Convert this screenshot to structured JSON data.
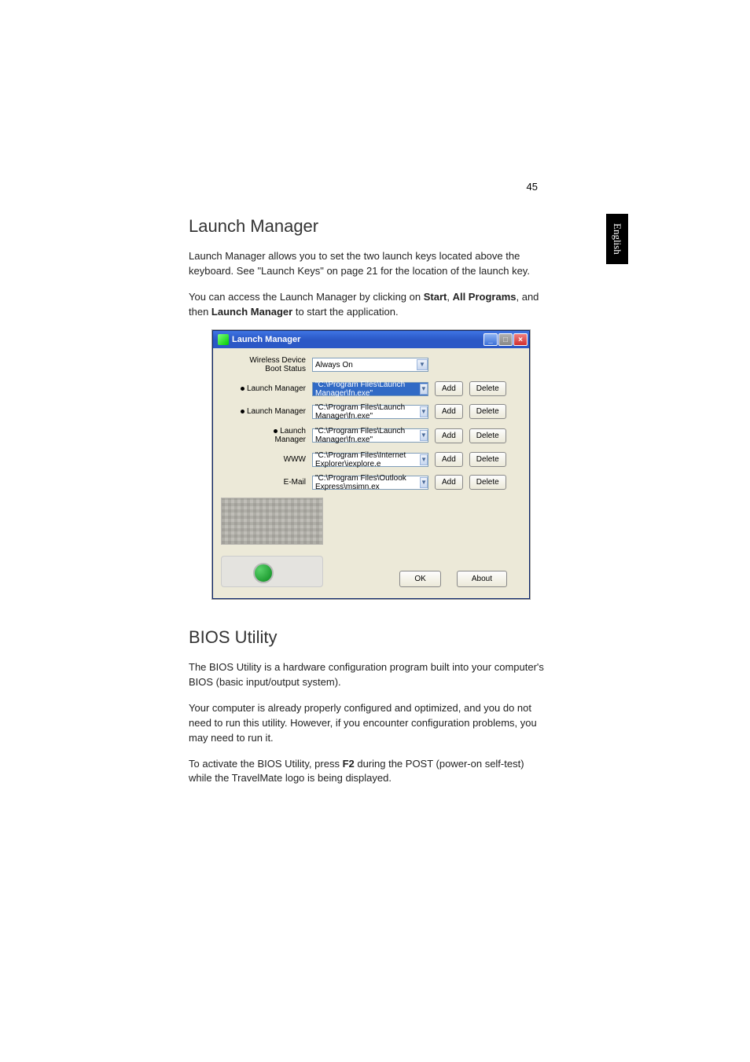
{
  "page_number": "45",
  "side_tab": "English",
  "launch_manager": {
    "heading": "Launch Manager",
    "para1": "Launch Manager allows you to set the two launch keys located above the keyboard. See \"Launch Keys\" on page 21 for the location of the launch key.",
    "para2_pre": "You can access the Launch Manager by clicking on ",
    "para2_start": "Start",
    "para2_mid1": ", ",
    "para2_all_programs": "All Programs",
    "para2_mid2": ", and then ",
    "para2_lm": "Launch Manager",
    "para2_post": " to start the application."
  },
  "lm_window": {
    "title": "Launch Manager",
    "min_symbol": "_",
    "max_symbol": "□",
    "close_symbol": "×",
    "rows": {
      "boot_status": {
        "label_line1": "Wireless Device",
        "label_line2": "Boot Status",
        "value": "Always On"
      },
      "r1": {
        "label": "Launch Manager",
        "path": "\"C:\\Program Files\\Launch Manager\\fn.exe\""
      },
      "r2": {
        "label": "Launch Manager",
        "path": "\"C:\\Program Files\\Launch Manager\\fn.exe\""
      },
      "r3": {
        "label": "Launch Manager",
        "path": "\"C:\\Program Files\\Launch Manager\\fn.exe\""
      },
      "r4": {
        "label": "WWW",
        "path": "\"C:\\Program Files\\Internet Explorer\\iexplore.e"
      },
      "r5": {
        "label": "E-Mail",
        "path": "\"C:\\Program Files\\Outlook Express\\msimn.ex"
      }
    },
    "buttons": {
      "add": "Add",
      "delete": "Delete",
      "ok": "OK",
      "about": "About"
    },
    "arrow": "▼"
  },
  "bios": {
    "heading": "BIOS Utility",
    "para1": "The BIOS Utility is a hardware configuration program built into your computer's BIOS (basic input/output system).",
    "para2": "Your computer is already properly configured and optimized, and you do not need to run this utility. However, if you encounter configuration problems, you may need to run it.",
    "para3_pre": "To activate the BIOS Utility, press ",
    "para3_f2": "F2",
    "para3_post": " during the POST (power-on self-test) while the TravelMate logo is being displayed."
  }
}
